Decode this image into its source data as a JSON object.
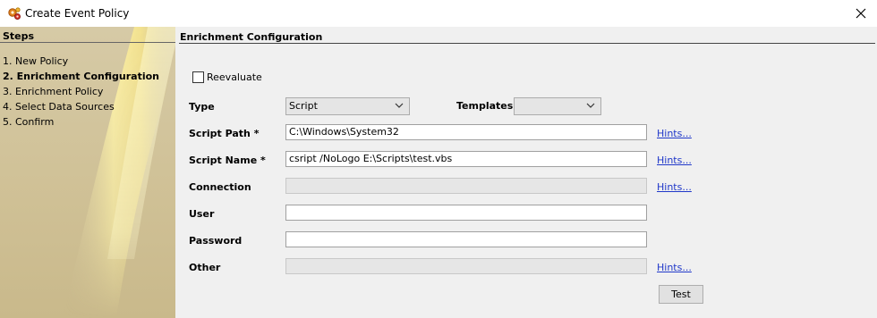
{
  "window": {
    "title": "Create Event Policy",
    "icon": "gear-cluster-icon",
    "close_icon": "close-icon"
  },
  "sidebar": {
    "header": "Steps",
    "steps": [
      {
        "label": "1. New Policy",
        "current": false
      },
      {
        "label": "2. Enrichment Configuration",
        "current": true
      },
      {
        "label": "3. Enrichment Policy",
        "current": false
      },
      {
        "label": "4. Select Data Sources",
        "current": false
      },
      {
        "label": "5. Confirm",
        "current": false
      }
    ]
  },
  "main": {
    "section_title": "Enrichment Configuration",
    "reevaluate": {
      "label": "Reevaluate",
      "checked": false
    },
    "type": {
      "label": "Type",
      "value": "Script"
    },
    "templates": {
      "label": "Templates",
      "value": ""
    },
    "script_path": {
      "label": "Script Path *",
      "value": "C:\\Windows\\System32",
      "hint": "Hints..."
    },
    "script_name": {
      "label": "Script Name *",
      "value": "csript /NoLogo E:\\Scripts\\test.vbs",
      "hint": "Hints..."
    },
    "connection": {
      "label": "Connection",
      "value": "",
      "hint": "Hints..."
    },
    "user": {
      "label": "User",
      "value": ""
    },
    "password": {
      "label": "Password",
      "value": ""
    },
    "other": {
      "label": "Other",
      "value": "",
      "hint": "Hints..."
    },
    "test_button": "Test"
  },
  "colors": {
    "link": "#1f37c9",
    "sidebar_bg": "#d6caa6",
    "sidebar_highlight": "#fff6b0"
  }
}
